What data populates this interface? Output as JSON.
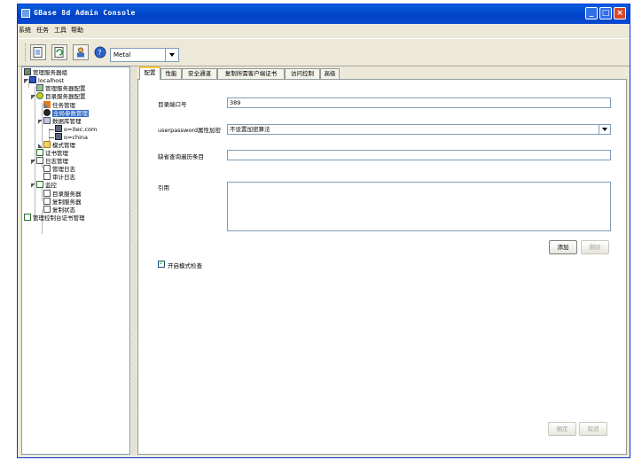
{
  "window": {
    "title": "GBase 8d  Admin  Console"
  },
  "menu": [
    "系统",
    "任务",
    "工具",
    "帮助"
  ],
  "toolbar": {
    "laf_value": "Metal"
  },
  "tree": {
    "root": "管理服务器组",
    "localhost": "localhost",
    "admin_config": "管理服务器配置",
    "dir_config": "目录服务器配置",
    "task_mgmt": "任务管理",
    "global_params": "全局参数管理",
    "db_mgmt": "数据库管理",
    "db1": "o=itec.com",
    "db2": "o=china",
    "schema_mgmt": "模式管理",
    "cert_mgmt": "证书管理",
    "log_mgmt": "日志管理",
    "mgmt_log": "管理日志",
    "audit_log": "审计日志",
    "monitor": "监控",
    "dir_server": "目录服务器",
    "repl_server": "复制服务器",
    "repl_status": "复制状态",
    "console_cert": "管理控制台证书管理"
  },
  "tabs": [
    "配置",
    "性能",
    "安全通道",
    "复制所需客户端证书",
    "访问控制",
    "高级"
  ],
  "form": {
    "port_label": "目录端口号",
    "port_value": "389",
    "pwd_label": "userpassword属性加密",
    "pwd_value": "不设置加密算法",
    "lookthrough_label": "缺省查询遍历条目",
    "lookthrough_value": "",
    "referral_label": "引用",
    "referral_value": "",
    "add_label": "添加",
    "delete_label": "删除",
    "schema_check_label": "开启模式检查",
    "schema_check_checked": true,
    "ok_label": "确定",
    "cancel_label": "取消"
  }
}
